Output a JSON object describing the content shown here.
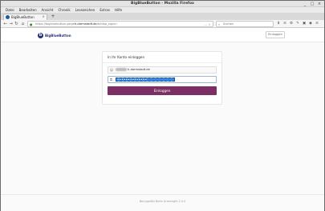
{
  "window": {
    "title": "BigBlueButton - Mozilla Firefox",
    "controls": [
      "_",
      "□",
      "×"
    ]
  },
  "menu": [
    "Datei",
    "Bearbeiten",
    "Ansicht",
    "Chronik",
    "Lesezeichen",
    "Extras",
    "Hilfe"
  ],
  "tab": {
    "label": "BigBlueButton",
    "close": "×"
  },
  "newtab": "+",
  "nav": {
    "back": "←",
    "forward": "→",
    "reload": "↻",
    "home": "⌂",
    "lock": "🔒",
    "url_prefix": "https://bigbluebutton.gsige",
    "url_domain": "h-darmstadt.de",
    "url_path": "/b/ldap_signin",
    "url_icons": "… ☆",
    "search_placeholder": "Suchen",
    "tool_icons": [
      "⬇",
      "≡",
      "⚙",
      "✎",
      "▣",
      "◉",
      "≡"
    ]
  },
  "page": {
    "logo_text": "BigBlueButton",
    "logo_mark": "b",
    "signin_button": "Einloggen",
    "card_title": "In Ihr Konto einloggen",
    "username_suffix": "h-darmstadt.de",
    "username_icon": "👤",
    "password_icon": "🔑",
    "password_mask": "••••••••••••••",
    "login_button": "Einloggen",
    "footer": "BerryginBtl Binte Greenlight 2.9.0"
  },
  "colors": {
    "brand": "#283274",
    "login": "#7c2f63",
    "selection": "#3b87e0"
  }
}
